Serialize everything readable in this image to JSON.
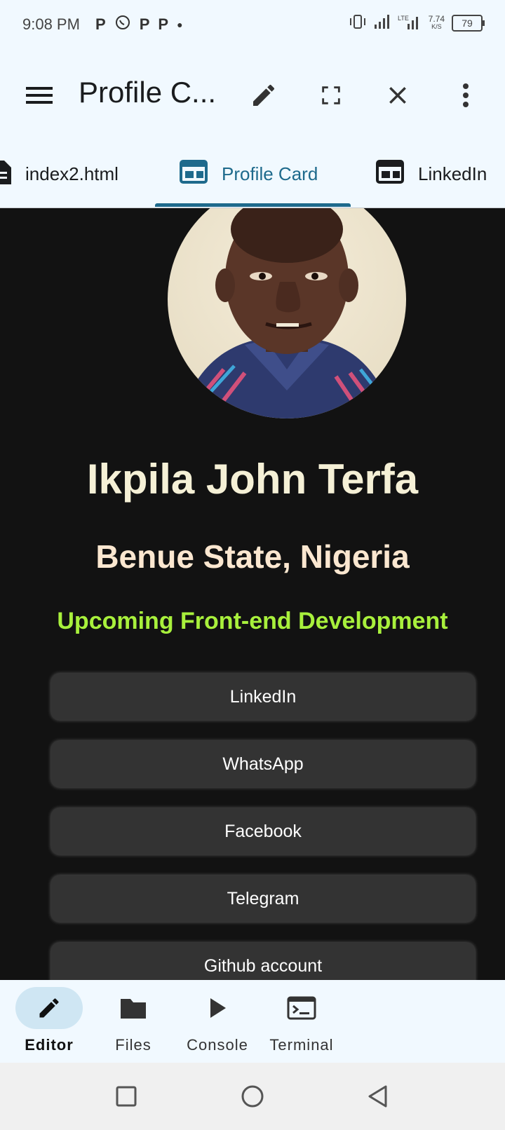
{
  "status": {
    "time": "9:08 PM",
    "speed": "7.74",
    "speed_unit": "K/S",
    "battery": "79"
  },
  "appbar": {
    "title": "Profile C..."
  },
  "tabs": [
    {
      "label": "index2.html",
      "icon": "file-icon"
    },
    {
      "label": "Profile Card",
      "icon": "web-icon"
    },
    {
      "label": "LinkedIn",
      "icon": "web-icon"
    }
  ],
  "profile": {
    "name": "Ikpila John Terfa",
    "location": "Benue State, Nigeria",
    "tagline": "Upcoming Front-end Development",
    "links": [
      "LinkedIn",
      "WhatsApp",
      "Facebook",
      "Telegram",
      "Github account"
    ]
  },
  "bottom_nav": [
    {
      "label": "Editor"
    },
    {
      "label": "Files"
    },
    {
      "label": "Console"
    },
    {
      "label": "Terminal"
    }
  ],
  "colors": {
    "accent": "#1e6a8c",
    "name": "#f5f0d6",
    "location": "#fbe7d0",
    "tagline": "#a8f03c",
    "button": "#333333",
    "background": "#121212"
  }
}
